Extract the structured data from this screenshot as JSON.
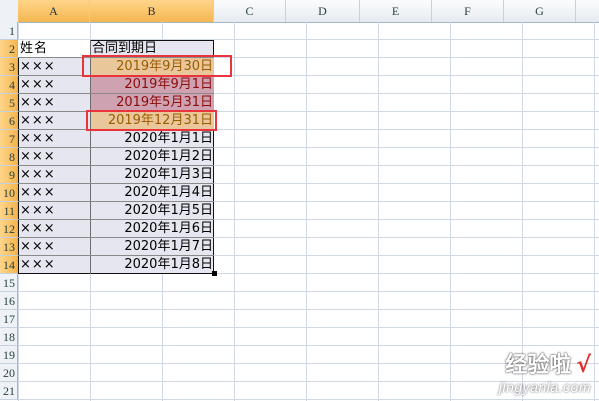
{
  "columns": [
    "A",
    "B",
    "C",
    "D",
    "E",
    "F",
    "G"
  ],
  "rows": [
    "1",
    "2",
    "3",
    "4",
    "5",
    "6",
    "7",
    "8",
    "9",
    "10",
    "11",
    "12",
    "13",
    "14",
    "15",
    "16",
    "17",
    "18",
    "19",
    "20",
    "21"
  ],
  "table": {
    "header": {
      "name": "姓名",
      "date": "合同到期日"
    },
    "records": [
      {
        "name": "×××",
        "date": "2019年9月30日"
      },
      {
        "name": "×××",
        "date": "2019年9月1日"
      },
      {
        "name": "×××",
        "date": "2019年5月31日"
      },
      {
        "name": "×××",
        "date": "2019年12月31日"
      },
      {
        "name": "×××",
        "date": "2020年1月1日"
      },
      {
        "name": "×××",
        "date": "2020年1月2日"
      },
      {
        "name": "×××",
        "date": "2020年1月3日"
      },
      {
        "name": "×××",
        "date": "2020年1月4日"
      },
      {
        "name": "×××",
        "date": "2020年1月5日"
      },
      {
        "name": "×××",
        "date": "2020年1月6日"
      },
      {
        "name": "×××",
        "date": "2020年1月7日"
      },
      {
        "name": "×××",
        "date": "2020年1月8日"
      }
    ]
  },
  "colors": {
    "highlight_gold": "#e9c79a",
    "highlight_rose": "#cfa2b1",
    "annotation_red": "#e8343a"
  },
  "watermark": {
    "title": "经验啦",
    "check": "√",
    "url": "jingyanla.com"
  }
}
